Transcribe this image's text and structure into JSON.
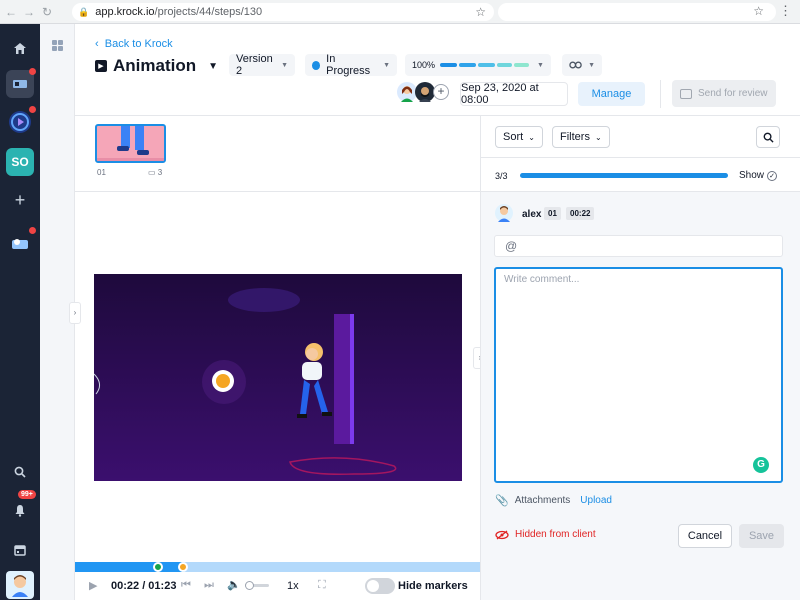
{
  "browser": {
    "url_host": "app.krock.io",
    "url_path": "/projects/44/steps/130"
  },
  "rail": {
    "workspace_initials": "SO",
    "notifications_badge": "99+"
  },
  "header": {
    "back_label": "Back to Krock",
    "title": "Animation",
    "version_label": "Version 2",
    "status_label": "In Progress",
    "progress_label": "100%",
    "progress_value": 1.0,
    "due_date": "Sep 23, 2020 at 08:00",
    "manage_label": "Manage",
    "send_review_label": "Send for review",
    "colors": {
      "accent": "#1b8ee5",
      "status": "#1b8ee5"
    }
  },
  "thumbnails": [
    {
      "index": "01",
      "comments": "3"
    }
  ],
  "player": {
    "time": "00:22 / 01:23",
    "speed": "1x",
    "hide_markers_label": "Hide markers",
    "progress": 0.27,
    "markers": [
      {
        "position": 0.206,
        "color": "#16a34a"
      },
      {
        "position": 0.267,
        "color": "#f5a623"
      }
    ]
  },
  "panel": {
    "sort_label": "Sort",
    "filters_label": "Filters",
    "count_label": "3/3",
    "show_label": "Show",
    "user": {
      "name": "alex",
      "frame": "01",
      "time": "00:22"
    },
    "mention_symbol": "@",
    "comment_placeholder": "Write comment...",
    "attachments_label": "Attachments",
    "upload_label": "Upload",
    "hidden_label": "Hidden from client",
    "cancel_label": "Cancel",
    "save_label": "Save"
  }
}
